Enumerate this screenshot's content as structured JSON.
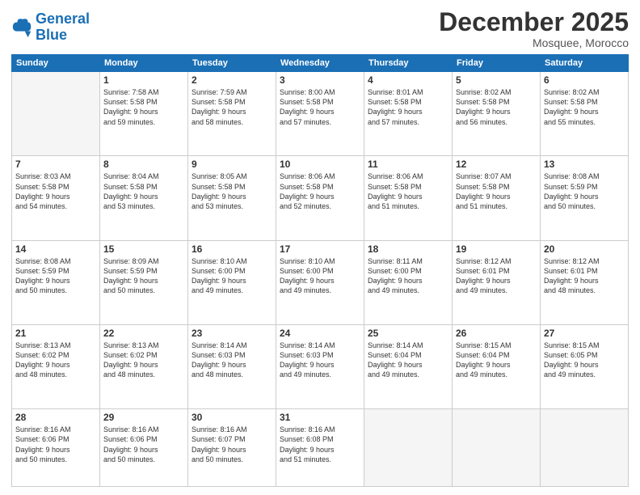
{
  "logo": {
    "line1": "General",
    "line2": "Blue"
  },
  "title": "December 2025",
  "location": "Mosquee, Morocco",
  "header_days": [
    "Sunday",
    "Monday",
    "Tuesday",
    "Wednesday",
    "Thursday",
    "Friday",
    "Saturday"
  ],
  "weeks": [
    [
      {
        "day": "",
        "info": ""
      },
      {
        "day": "1",
        "info": "Sunrise: 7:58 AM\nSunset: 5:58 PM\nDaylight: 9 hours\nand 59 minutes."
      },
      {
        "day": "2",
        "info": "Sunrise: 7:59 AM\nSunset: 5:58 PM\nDaylight: 9 hours\nand 58 minutes."
      },
      {
        "day": "3",
        "info": "Sunrise: 8:00 AM\nSunset: 5:58 PM\nDaylight: 9 hours\nand 57 minutes."
      },
      {
        "day": "4",
        "info": "Sunrise: 8:01 AM\nSunset: 5:58 PM\nDaylight: 9 hours\nand 57 minutes."
      },
      {
        "day": "5",
        "info": "Sunrise: 8:02 AM\nSunset: 5:58 PM\nDaylight: 9 hours\nand 56 minutes."
      },
      {
        "day": "6",
        "info": "Sunrise: 8:02 AM\nSunset: 5:58 PM\nDaylight: 9 hours\nand 55 minutes."
      }
    ],
    [
      {
        "day": "7",
        "info": "Sunrise: 8:03 AM\nSunset: 5:58 PM\nDaylight: 9 hours\nand 54 minutes."
      },
      {
        "day": "8",
        "info": "Sunrise: 8:04 AM\nSunset: 5:58 PM\nDaylight: 9 hours\nand 53 minutes."
      },
      {
        "day": "9",
        "info": "Sunrise: 8:05 AM\nSunset: 5:58 PM\nDaylight: 9 hours\nand 53 minutes."
      },
      {
        "day": "10",
        "info": "Sunrise: 8:06 AM\nSunset: 5:58 PM\nDaylight: 9 hours\nand 52 minutes."
      },
      {
        "day": "11",
        "info": "Sunrise: 8:06 AM\nSunset: 5:58 PM\nDaylight: 9 hours\nand 51 minutes."
      },
      {
        "day": "12",
        "info": "Sunrise: 8:07 AM\nSunset: 5:58 PM\nDaylight: 9 hours\nand 51 minutes."
      },
      {
        "day": "13",
        "info": "Sunrise: 8:08 AM\nSunset: 5:59 PM\nDaylight: 9 hours\nand 50 minutes."
      }
    ],
    [
      {
        "day": "14",
        "info": "Sunrise: 8:08 AM\nSunset: 5:59 PM\nDaylight: 9 hours\nand 50 minutes."
      },
      {
        "day": "15",
        "info": "Sunrise: 8:09 AM\nSunset: 5:59 PM\nDaylight: 9 hours\nand 50 minutes."
      },
      {
        "day": "16",
        "info": "Sunrise: 8:10 AM\nSunset: 6:00 PM\nDaylight: 9 hours\nand 49 minutes."
      },
      {
        "day": "17",
        "info": "Sunrise: 8:10 AM\nSunset: 6:00 PM\nDaylight: 9 hours\nand 49 minutes."
      },
      {
        "day": "18",
        "info": "Sunrise: 8:11 AM\nSunset: 6:00 PM\nDaylight: 9 hours\nand 49 minutes."
      },
      {
        "day": "19",
        "info": "Sunrise: 8:12 AM\nSunset: 6:01 PM\nDaylight: 9 hours\nand 49 minutes."
      },
      {
        "day": "20",
        "info": "Sunrise: 8:12 AM\nSunset: 6:01 PM\nDaylight: 9 hours\nand 48 minutes."
      }
    ],
    [
      {
        "day": "21",
        "info": "Sunrise: 8:13 AM\nSunset: 6:02 PM\nDaylight: 9 hours\nand 48 minutes."
      },
      {
        "day": "22",
        "info": "Sunrise: 8:13 AM\nSunset: 6:02 PM\nDaylight: 9 hours\nand 48 minutes."
      },
      {
        "day": "23",
        "info": "Sunrise: 8:14 AM\nSunset: 6:03 PM\nDaylight: 9 hours\nand 48 minutes."
      },
      {
        "day": "24",
        "info": "Sunrise: 8:14 AM\nSunset: 6:03 PM\nDaylight: 9 hours\nand 49 minutes."
      },
      {
        "day": "25",
        "info": "Sunrise: 8:14 AM\nSunset: 6:04 PM\nDaylight: 9 hours\nand 49 minutes."
      },
      {
        "day": "26",
        "info": "Sunrise: 8:15 AM\nSunset: 6:04 PM\nDaylight: 9 hours\nand 49 minutes."
      },
      {
        "day": "27",
        "info": "Sunrise: 8:15 AM\nSunset: 6:05 PM\nDaylight: 9 hours\nand 49 minutes."
      }
    ],
    [
      {
        "day": "28",
        "info": "Sunrise: 8:16 AM\nSunset: 6:06 PM\nDaylight: 9 hours\nand 50 minutes."
      },
      {
        "day": "29",
        "info": "Sunrise: 8:16 AM\nSunset: 6:06 PM\nDaylight: 9 hours\nand 50 minutes."
      },
      {
        "day": "30",
        "info": "Sunrise: 8:16 AM\nSunset: 6:07 PM\nDaylight: 9 hours\nand 50 minutes."
      },
      {
        "day": "31",
        "info": "Sunrise: 8:16 AM\nSunset: 6:08 PM\nDaylight: 9 hours\nand 51 minutes."
      },
      {
        "day": "",
        "info": ""
      },
      {
        "day": "",
        "info": ""
      },
      {
        "day": "",
        "info": ""
      }
    ]
  ]
}
